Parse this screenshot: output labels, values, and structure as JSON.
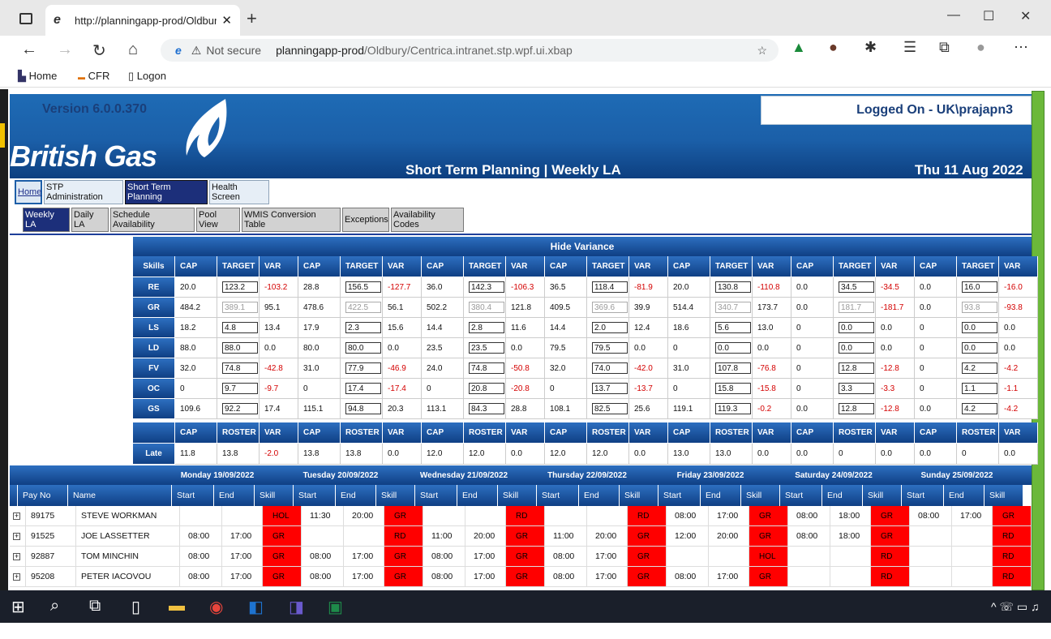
{
  "browser": {
    "tab_title": "http://planningapp-prod/Oldbur",
    "tab_close": "✕",
    "new_tab": "+",
    "not_secure": "Not secure",
    "url_host": "planningapp-prod",
    "url_path": "/Oldbury/Centrica.intranet.stp.wpf.ui.xbap",
    "favorites": [
      {
        "icon": "home-icon",
        "label": "Home"
      },
      {
        "icon": "cfr-icon",
        "label": "CFR"
      },
      {
        "icon": "page-icon",
        "label": "Logon"
      }
    ]
  },
  "header": {
    "version": "Version 6.0.0.370",
    "logo_text": "British Gas",
    "logged_on": "Logged On - UK\\prajapn3",
    "title": "Short Term Planning | Weekly LA",
    "date": "Thu 11 Aug 2022"
  },
  "main_menu": [
    "Home",
    "STP Administration",
    "Short Term Planning",
    "Health Screen"
  ],
  "sub_menu": [
    "Weekly LA",
    "Daily LA",
    "Schedule Availability",
    "Pool View",
    "WMIS Conversion Table",
    "Exceptions",
    "Availability Codes"
  ],
  "variance": {
    "toggle_label": "Hide Variance",
    "skills_label": "Skills",
    "col_labels": [
      "CAP",
      "TARGET",
      "VAR"
    ],
    "rows": [
      {
        "skill": "RE",
        "days": [
          [
            "20.0",
            "123.2",
            "-103.2"
          ],
          [
            "28.8",
            "156.5",
            "-127.7"
          ],
          [
            "36.0",
            "142.3",
            "-106.3"
          ],
          [
            "36.5",
            "118.4",
            "-81.9"
          ],
          [
            "20.0",
            "130.8",
            "-110.8"
          ],
          [
            "0.0",
            "34.5",
            "-34.5"
          ],
          [
            "0.0",
            "16.0",
            "-16.0"
          ]
        ]
      },
      {
        "skill": "GR",
        "days": [
          [
            "484.2",
            "389.1",
            "95.1"
          ],
          [
            "478.6",
            "422.5",
            "56.1"
          ],
          [
            "502.2",
            "380.4",
            "121.8"
          ],
          [
            "409.5",
            "369.6",
            "39.9"
          ],
          [
            "514.4",
            "340.7",
            "173.7"
          ],
          [
            "0.0",
            "181.7",
            "-181.7"
          ],
          [
            "0.0",
            "93.8",
            "-93.8"
          ]
        ]
      },
      {
        "skill": "LS",
        "days": [
          [
            "18.2",
            "4.8",
            "13.4"
          ],
          [
            "17.9",
            "2.3",
            "15.6"
          ],
          [
            "14.4",
            "2.8",
            "11.6"
          ],
          [
            "14.4",
            "2.0",
            "12.4"
          ],
          [
            "18.6",
            "5.6",
            "13.0"
          ],
          [
            "0",
            "0.0",
            "0.0"
          ],
          [
            "0",
            "0.0",
            "0.0"
          ]
        ]
      },
      {
        "skill": "LD",
        "days": [
          [
            "88.0",
            "88.0",
            "0.0"
          ],
          [
            "80.0",
            "80.0",
            "0.0"
          ],
          [
            "23.5",
            "23.5",
            "0.0"
          ],
          [
            "79.5",
            "79.5",
            "0.0"
          ],
          [
            "0",
            "0.0",
            "0.0"
          ],
          [
            "0",
            "0.0",
            "0.0"
          ],
          [
            "0",
            "0.0",
            "0.0"
          ]
        ]
      },
      {
        "skill": "FV",
        "days": [
          [
            "32.0",
            "74.8",
            "-42.8"
          ],
          [
            "31.0",
            "77.9",
            "-46.9"
          ],
          [
            "24.0",
            "74.8",
            "-50.8"
          ],
          [
            "32.0",
            "74.0",
            "-42.0"
          ],
          [
            "31.0",
            "107.8",
            "-76.8"
          ],
          [
            "0",
            "12.8",
            "-12.8"
          ],
          [
            "0",
            "4.2",
            "-4.2"
          ]
        ]
      },
      {
        "skill": "OC",
        "days": [
          [
            "0",
            "9.7",
            "-9.7"
          ],
          [
            "0",
            "17.4",
            "-17.4"
          ],
          [
            "0",
            "20.8",
            "-20.8"
          ],
          [
            "0",
            "13.7",
            "-13.7"
          ],
          [
            "0",
            "15.8",
            "-15.8"
          ],
          [
            "0",
            "3.3",
            "-3.3"
          ],
          [
            "0",
            "1.1",
            "-1.1"
          ]
        ]
      },
      {
        "skill": "GS",
        "days": [
          [
            "109.6",
            "92.2",
            "17.4"
          ],
          [
            "115.1",
            "94.8",
            "20.3"
          ],
          [
            "113.1",
            "84.3",
            "28.8"
          ],
          [
            "108.1",
            "82.5",
            "25.6"
          ],
          [
            "119.1",
            "119.3",
            "-0.2"
          ],
          [
            "0.0",
            "12.8",
            "-12.8"
          ],
          [
            "0.0",
            "4.2",
            "-4.2"
          ]
        ]
      }
    ],
    "late_col_labels": [
      "CAP",
      "ROSTER",
      "VAR"
    ],
    "late": {
      "skill": "Late",
      "days": [
        [
          "11.8",
          "13.8",
          "-2.0"
        ],
        [
          "13.8",
          "13.8",
          "0.0"
        ],
        [
          "12.0",
          "12.0",
          "0.0"
        ],
        [
          "12.0",
          "12.0",
          "0.0"
        ],
        [
          "13.0",
          "13.0",
          "0.0"
        ],
        [
          "0.0",
          "0",
          "0.0"
        ],
        [
          "0.0",
          "0",
          "0.0"
        ]
      ]
    }
  },
  "schedule": {
    "days": [
      "Monday 19/09/2022",
      "Tuesday 20/09/2022",
      "Wednesday 21/09/2022",
      "Thursday 22/09/2022",
      "Friday 23/09/2022",
      "Saturday 24/09/2022",
      "Sunday 25/09/2022"
    ],
    "col_payno": "Pay No",
    "col_name": "Name",
    "col_start": "Start",
    "col_end": "End",
    "col_skill": "Skill",
    "rows": [
      {
        "payno": "89175",
        "name": "STEVE WORKMAN",
        "days": [
          [
            "",
            "",
            "HOL"
          ],
          [
            "11:30",
            "20:00",
            "GR"
          ],
          [
            "",
            "",
            "RD"
          ],
          [
            "",
            "",
            "RD"
          ],
          [
            "08:00",
            "17:00",
            "GR"
          ],
          [
            "08:00",
            "18:00",
            "GR"
          ],
          [
            "08:00",
            "17:00",
            "GR"
          ]
        ]
      },
      {
        "payno": "91525",
        "name": "JOE LASSETTER",
        "days": [
          [
            "08:00",
            "17:00",
            "GR"
          ],
          [
            "",
            "",
            "RD"
          ],
          [
            "11:00",
            "20:00",
            "GR"
          ],
          [
            "11:00",
            "20:00",
            "GR"
          ],
          [
            "12:00",
            "20:00",
            "GR"
          ],
          [
            "08:00",
            "18:00",
            "GR"
          ],
          [
            "",
            "",
            "RD"
          ]
        ]
      },
      {
        "payno": "92887",
        "name": "TOM MINCHIN",
        "days": [
          [
            "08:00",
            "17:00",
            "GR"
          ],
          [
            "08:00",
            "17:00",
            "GR"
          ],
          [
            "08:00",
            "17:00",
            "GR"
          ],
          [
            "08:00",
            "17:00",
            "GR"
          ],
          [
            "",
            "",
            "HOL"
          ],
          [
            "",
            "",
            "RD"
          ],
          [
            "",
            "",
            "RD"
          ]
        ]
      },
      {
        "payno": "95208",
        "name": "PETER IACOVOU",
        "days": [
          [
            "08:00",
            "17:00",
            "GR"
          ],
          [
            "08:00",
            "17:00",
            "GR"
          ],
          [
            "08:00",
            "17:00",
            "GR"
          ],
          [
            "08:00",
            "17:00",
            "GR"
          ],
          [
            "08:00",
            "17:00",
            "GR"
          ],
          [
            "",
            "",
            "RD"
          ],
          [
            "",
            "",
            "RD"
          ]
        ]
      }
    ]
  }
}
